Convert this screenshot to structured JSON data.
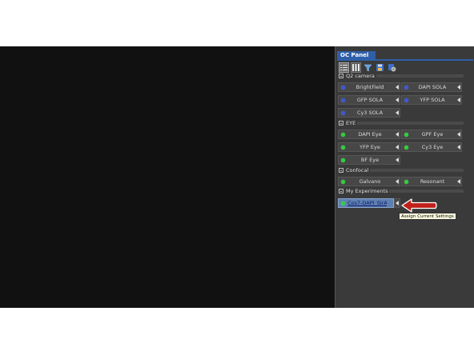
{
  "panel": {
    "title": "OC Panel"
  },
  "toolbar": {
    "icons": [
      "list-view-icon",
      "grid-view-icon",
      "filter-funnel-icon",
      "save-config-icon",
      "settings-config-icon"
    ]
  },
  "sections": {
    "q2_camera": {
      "label": "Q2 camera",
      "buttons": [
        {
          "label": "BrightField",
          "status_color": "#3b56d8"
        },
        {
          "label": "DAPI SOLA",
          "status_color": "#3b56d8"
        },
        {
          "label": "GFP SOLA",
          "status_color": "#3b56d8"
        },
        {
          "label": "YFP SOLA",
          "status_color": "#3b56d8"
        },
        {
          "label": "Cy3 SOLA",
          "status_color": "#3b56d8"
        }
      ]
    },
    "eye": {
      "label": "EYE",
      "buttons": [
        {
          "label": "DAPI Eye",
          "status_color": "#2fcf3a"
        },
        {
          "label": "GPF Eye",
          "status_color": "#2fcf3a"
        },
        {
          "label": "YFP Eye",
          "status_color": "#2fcf3a"
        },
        {
          "label": "Cy3 Eye",
          "status_color": "#2fcf3a"
        },
        {
          "label": "BF Eye",
          "status_color": "#2fcf3a"
        }
      ]
    },
    "confocal": {
      "label": "Confocal",
      "buttons": [
        {
          "label": "Galvano",
          "status_color": "#2fcf3a"
        },
        {
          "label": "Resonant",
          "status_color": "#2fcf3a"
        }
      ]
    },
    "my_experiments": {
      "label": "My Experiments",
      "buttons": [
        {
          "label": "Cos7-DAPI_SirActin",
          "status_color": "#2fcf3a"
        }
      ]
    }
  },
  "tooltip": {
    "text": "Assign Current Settings"
  },
  "colors": {
    "panel_bg": "#3a3a3a",
    "title_blue": "#2f5fa8",
    "annotation_arrow": "#c0201a"
  }
}
